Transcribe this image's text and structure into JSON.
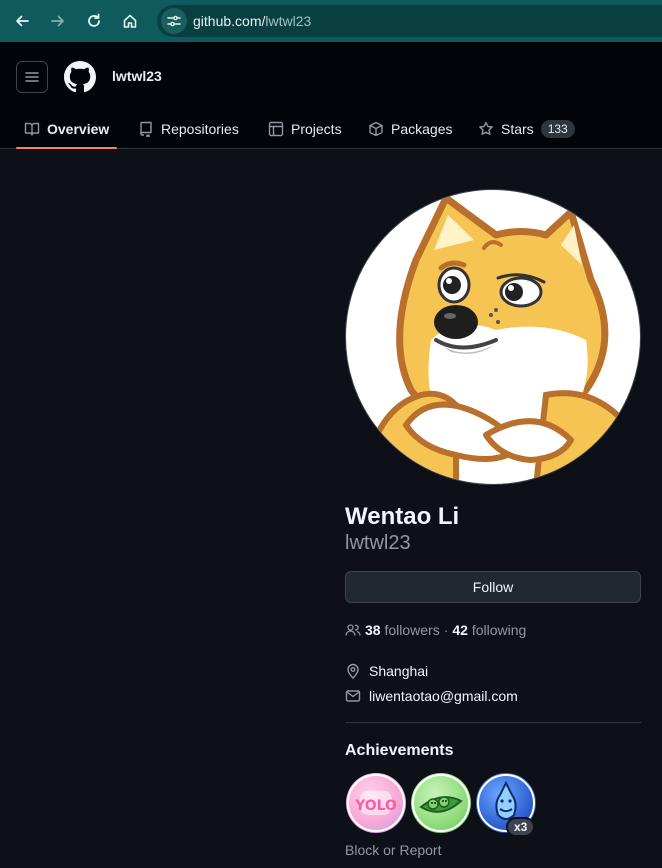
{
  "browser": {
    "url_host": "github.com/",
    "url_path": "lwtwl23"
  },
  "header": {
    "username": "lwtwl23"
  },
  "tabs": [
    {
      "label": "Overview",
      "icon": "book-icon",
      "active": true
    },
    {
      "label": "Repositories",
      "icon": "repo-icon",
      "active": false
    },
    {
      "label": "Projects",
      "icon": "table-icon",
      "active": false
    },
    {
      "label": "Packages",
      "icon": "package-icon",
      "active": false
    },
    {
      "label": "Stars",
      "icon": "star-icon",
      "active": false,
      "count": "133"
    }
  ],
  "profile": {
    "full_name": "Wentao Li",
    "login": "lwtwl23",
    "follow_label": "Follow",
    "followers_count": "38",
    "followers_label": "followers",
    "separator": "·",
    "following_count": "42",
    "following_label": "following",
    "location": "Shanghai",
    "email": "liwentaotao@gmail.com"
  },
  "achievements": {
    "title": "Achievements",
    "badges": [
      {
        "name": "yolo-badge",
        "text": "YOLO"
      },
      {
        "name": "pair-extraordinaire-badge"
      },
      {
        "name": "pull-shark-badge",
        "count": "x3"
      }
    ]
  },
  "footer": {
    "block_report": "Block or Report"
  },
  "colors": {
    "browser_bar": "#0f5a5c",
    "page_bg": "#0d1117",
    "header_bg": "#010409",
    "active_tab_underline": "#f78166"
  }
}
